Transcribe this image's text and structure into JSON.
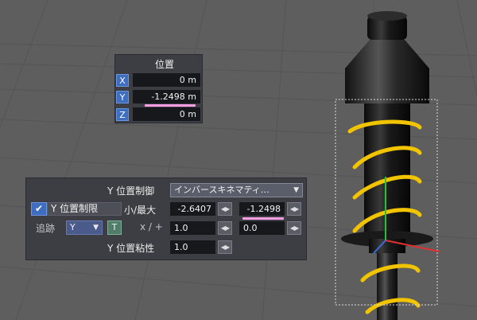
{
  "position_panel": {
    "title": "位置",
    "x": {
      "axis": "X",
      "value": "0 m"
    },
    "y": {
      "axis": "Y",
      "value": "-1.2498 m"
    },
    "z": {
      "axis": "Z",
      "value": "0 m"
    }
  },
  "constraint_panel": {
    "y_control_label": "Y 位置制御",
    "y_control_value": "インバースキネマティ…",
    "y_limit_checked": true,
    "y_limit_label": "Y 位置制限",
    "minmax_label": "小/最大",
    "min_value": "-2.6407",
    "max_value": "-1.2498",
    "trace_label": "追跡",
    "trace_axis": "Y",
    "trace_t": "T",
    "scale_label": "x / +",
    "scale_value": "1.0",
    "offset_value": "0.0",
    "y_viscosity_label": "Y 位置粘性",
    "y_viscosity_value": "1.0"
  },
  "colors": {
    "viewport_bg": "#5f5f5f",
    "panel_bg": "#3a3c42",
    "axis_button": "#3f6ec0",
    "highlight_underline": "#ff9ee4",
    "spring": "#f2c400"
  }
}
